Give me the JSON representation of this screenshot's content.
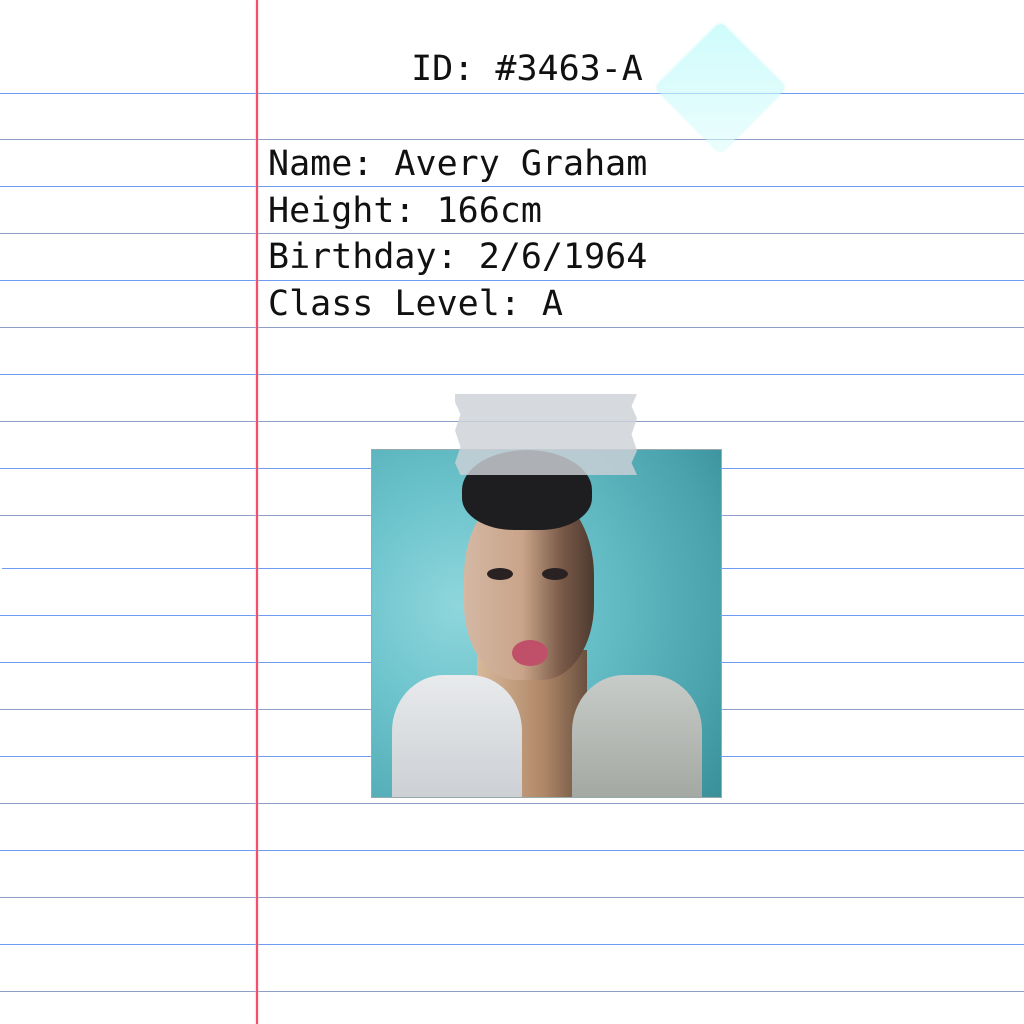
{
  "card": {
    "id_line": "ID: #3463-A",
    "fields": [
      "Name: Avery Graham",
      "Height: 166cm",
      "Birthday: 2/6/1964",
      "Class Level: A"
    ]
  },
  "colors": {
    "rule_line": "#6f9bf0",
    "margin_line": "#f0506e",
    "tape": "#d8dbe0",
    "diamond": "#c8fafa"
  }
}
